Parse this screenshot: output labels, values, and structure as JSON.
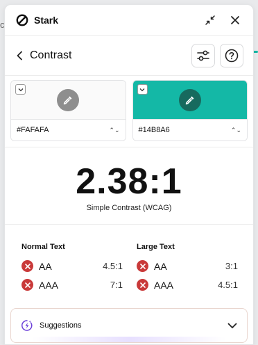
{
  "background": {
    "peek_text": "co"
  },
  "titlebar": {
    "app_name": "Stark",
    "collapse_icon": "collapse-icon",
    "close_icon": "close-icon"
  },
  "navbar": {
    "title": "Contrast",
    "back_icon": "chevron-left-icon",
    "settings_icon": "sliders-icon",
    "help_icon": "help-icon"
  },
  "swatches": [
    {
      "hex": "#FAFAFA",
      "color": "#FAFAFA",
      "dropper_bg": "#8E8E8E"
    },
    {
      "hex": "#14B8A6",
      "color": "#14B8A6",
      "dropper_bg": "#176A5E"
    }
  ],
  "result": {
    "ratio": "2.38:1",
    "caption": "Simple Contrast (WCAG)"
  },
  "compliance": {
    "normal": {
      "title": "Normal Text",
      "rows": [
        {
          "level": "AA",
          "threshold": "4.5:1",
          "status": "fail"
        },
        {
          "level": "AAA",
          "threshold": "7:1",
          "status": "fail"
        }
      ]
    },
    "large": {
      "title": "Large Text",
      "rows": [
        {
          "level": "AA",
          "threshold": "3:1",
          "status": "fail"
        },
        {
          "level": "AAA",
          "threshold": "4.5:1",
          "status": "fail"
        }
      ]
    }
  },
  "suggestions": {
    "label": "Suggestions",
    "icon": "lightning-icon",
    "chevron_icon": "chevron-down-icon"
  },
  "colors": {
    "accent": "#14B8A6",
    "fail": "#C93A3A",
    "suggestion_icon": "#6B3FD9"
  }
}
